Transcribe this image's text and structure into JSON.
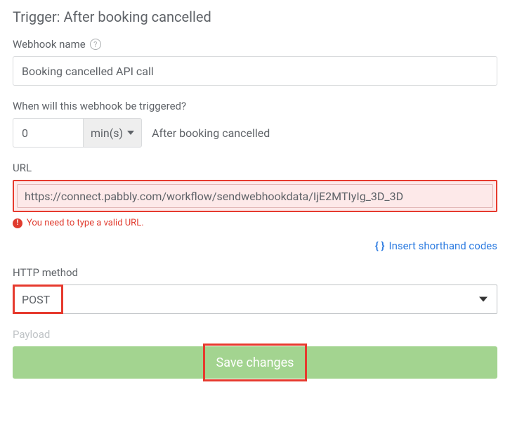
{
  "trigger": {
    "label": "Trigger:",
    "value": "After booking cancelled"
  },
  "webhookName": {
    "label": "Webhook name",
    "value": "Booking cancelled API call"
  },
  "timing": {
    "label": "When will this webhook be triggered?",
    "value": "0",
    "unit": "min(s)",
    "suffix": "After booking cancelled"
  },
  "url": {
    "label": "URL",
    "value": "https://connect.pabbly.com/workflow/sendwebhookdata/IjE2MTIyIg_3D_3D",
    "error": "You need to type a valid URL."
  },
  "shorthand": {
    "label": "Insert shorthand codes"
  },
  "method": {
    "label": "HTTP method",
    "value": "POST"
  },
  "payload": {
    "label": "Payload"
  },
  "save": {
    "label": "Save changes"
  }
}
